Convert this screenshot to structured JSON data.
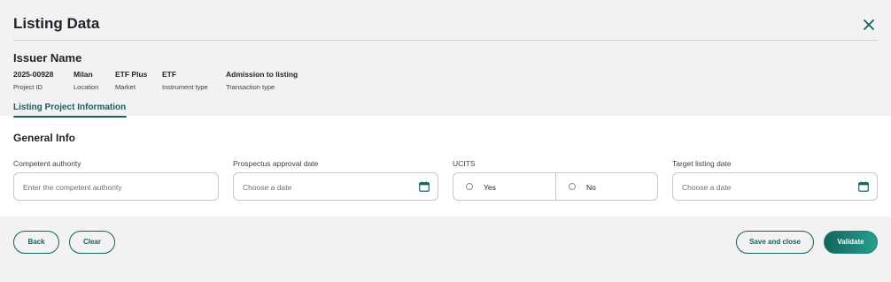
{
  "header": {
    "title": "Listing Data",
    "issuer_name": "Issuer Name",
    "meta": [
      {
        "value": "2025-00928",
        "label": "Project ID"
      },
      {
        "value": "Milan",
        "label": "Location"
      },
      {
        "value": "ETF Plus",
        "label": "Market"
      },
      {
        "value": "ETF",
        "label": "Instrument type"
      },
      {
        "value": "Admission to listing",
        "label": "Transaction type"
      }
    ]
  },
  "tabs": [
    {
      "label": "Listing Project Information",
      "active": true
    }
  ],
  "section": {
    "title": "General Info",
    "fields": {
      "competent_authority": {
        "label": "Competent authority",
        "placeholder": "Enter the competent authority",
        "value": ""
      },
      "prospectus_approval_date": {
        "label": "Prospectus approval date",
        "placeholder": "Choose a date",
        "value": ""
      },
      "ucits": {
        "label": "UCITS",
        "options": [
          "Yes",
          "No"
        ],
        "selected": null
      },
      "target_listing_date": {
        "label": "Target listing date",
        "placeholder": "Choose a date",
        "value": ""
      }
    }
  },
  "actions": {
    "back": "Back",
    "clear": "Clear",
    "save_and_close": "Save and close",
    "validate": "Validate"
  },
  "icons": {
    "close": "close-icon",
    "calendar": "calendar-icon"
  },
  "colors": {
    "accent": "#13635c",
    "accent_light": "#27a08f",
    "background": "#f2f2f2",
    "panel": "#ffffff"
  }
}
